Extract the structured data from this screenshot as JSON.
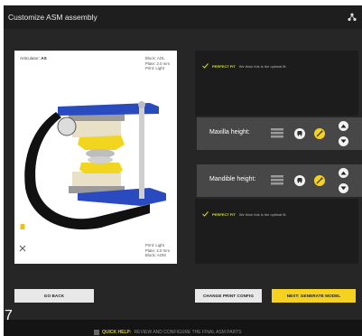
{
  "window": {
    "title": "Customize ASM assembly",
    "icon": "network-icon"
  },
  "viewer": {
    "articulator_label": "Articulator:",
    "articulator_value": "AS",
    "top_right": [
      "Block: AOL",
      "Plate: 2.0 mm",
      "Print: Light"
    ],
    "bottom_right": [
      "Print: Light",
      "Plate: 2.0 mm",
      "Block: AOM"
    ]
  },
  "maxilla_fit": {
    "tag": "PERFECT FIT",
    "message": "We think this is the optimal fit."
  },
  "mandible_fit": {
    "tag": "PERFECT FIT",
    "message": "We think this is the optimal fit."
  },
  "maxilla_height": {
    "label": "Maxilla height:"
  },
  "mandible_height": {
    "label": "Mandible height:"
  },
  "buttons": {
    "go_back": "GO BACK",
    "change_print": "CHANGE PRINT CONFIG",
    "next": "NEXT: GENERATE MODEL"
  },
  "help": {
    "highlight": "QUICK HELP:",
    "text": "REVIEW AND CONFIGURE THE FINAL ASM PARTS"
  },
  "page_number": "7",
  "colors": {
    "accent": "#f4d21f",
    "fit": "#d6e024",
    "panel": "#1c1c1c",
    "control": "#474747"
  }
}
